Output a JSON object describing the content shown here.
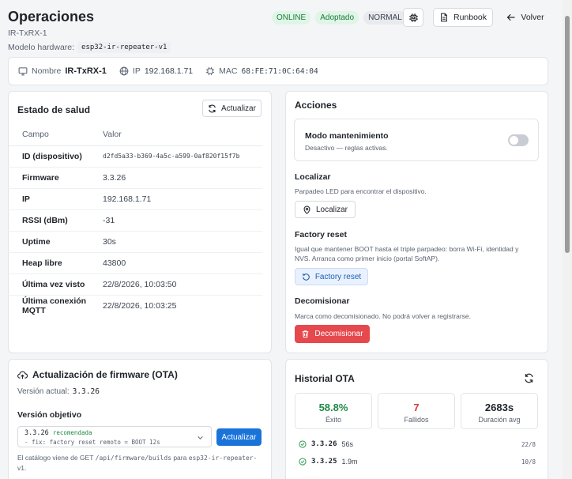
{
  "header": {
    "title": "Operaciones",
    "device_id": "IR-TxRX-1",
    "hardware_label": "Modelo hardware:",
    "hardware_model": "esp32-ir-repeater-v1",
    "badges": [
      "ONLINE",
      "Adoptado",
      "NORMAL"
    ],
    "runbook_label": "Runbook",
    "back_label": "Volver"
  },
  "identity": {
    "name_label": "Nombre",
    "name_value": "IR-TxRX-1",
    "ip_label": "IP",
    "ip_value": "192.168.1.71",
    "mac_label": "MAC",
    "mac_value": "68:FE:71:0C:64:04"
  },
  "health": {
    "title": "Estado de salud",
    "refresh_label": "Actualizar",
    "col_field": "Campo",
    "col_value": "Valor",
    "rows": [
      {
        "k": "ID (dispositivo)",
        "v": "d2fd5a33-b369-4a5c-a599-0af820f15f7b"
      },
      {
        "k": "Firmware",
        "v": "3.3.26"
      },
      {
        "k": "IP",
        "v": "192.168.1.71"
      },
      {
        "k": "RSSI (dBm)",
        "v": "-31"
      },
      {
        "k": "Uptime",
        "v": "30s"
      },
      {
        "k": "Heap libre",
        "v": "43800"
      },
      {
        "k": "Última vez visto",
        "v": "22/8/2026, 10:03:50"
      },
      {
        "k": "Última conexión MQTT",
        "v": "22/8/2026, 10:03:25"
      }
    ]
  },
  "actions": {
    "title": "Acciones",
    "maintenance_title": "Modo mantenimiento",
    "maintenance_desc": "Desactivo — reglas activas.",
    "maintenance_on": false,
    "locate_title": "Localizar",
    "locate_desc": "Parpadeo LED para encontrar el dispositivo.",
    "locate_button": "Localizar",
    "factory_title": "Factory reset",
    "factory_desc_1": "Igual que mantener BOOT hasta el triple parpadeo: borra Wi-Fi, identidad y",
    "factory_desc_2": "NVS. Arranca como primer inicio (portal SoftAP).",
    "factory_button": "Factory reset",
    "decom_title": "Decomisionar",
    "decom_desc": "Marca como decomisionado. No podrá volver a registrarse.",
    "decom_button": "Decomisionar"
  },
  "ota": {
    "title": "Actualización de firmware (OTA)",
    "current_label": "Versión actual:",
    "current_version": "3.3.26",
    "target_label": "Versión objetivo",
    "option_version": "3.3.26",
    "option_tag": "recomendada",
    "option_note": "- fix: factory reset remoto = BOOT 12s",
    "update_button": "Actualizar",
    "catalog_pre": "El catálogo viene de GET",
    "catalog_path": "/api/firmware/builds",
    "catalog_mid": "para",
    "catalog_model": "esp32-ir-repeater-",
    "catalog_end": "v1."
  },
  "history": {
    "title": "Historial OTA",
    "stats": [
      {
        "value": "58.8%",
        "label": "Éxito",
        "color": "#1f8a46"
      },
      {
        "value": "7",
        "label": "Fallidos",
        "color": "#d63a3a"
      },
      {
        "value": "2683s",
        "label": "Duración avg",
        "color": "#1f2328"
      }
    ],
    "entries": [
      {
        "version": "3.3.26",
        "duration": "56s",
        "date": "22/8"
      },
      {
        "version": "3.3.25",
        "duration": "1.9m",
        "date": "10/8"
      }
    ]
  },
  "colors": {
    "accent": "#1a73d9",
    "danger": "#e5484d",
    "success": "#2f9e55"
  }
}
